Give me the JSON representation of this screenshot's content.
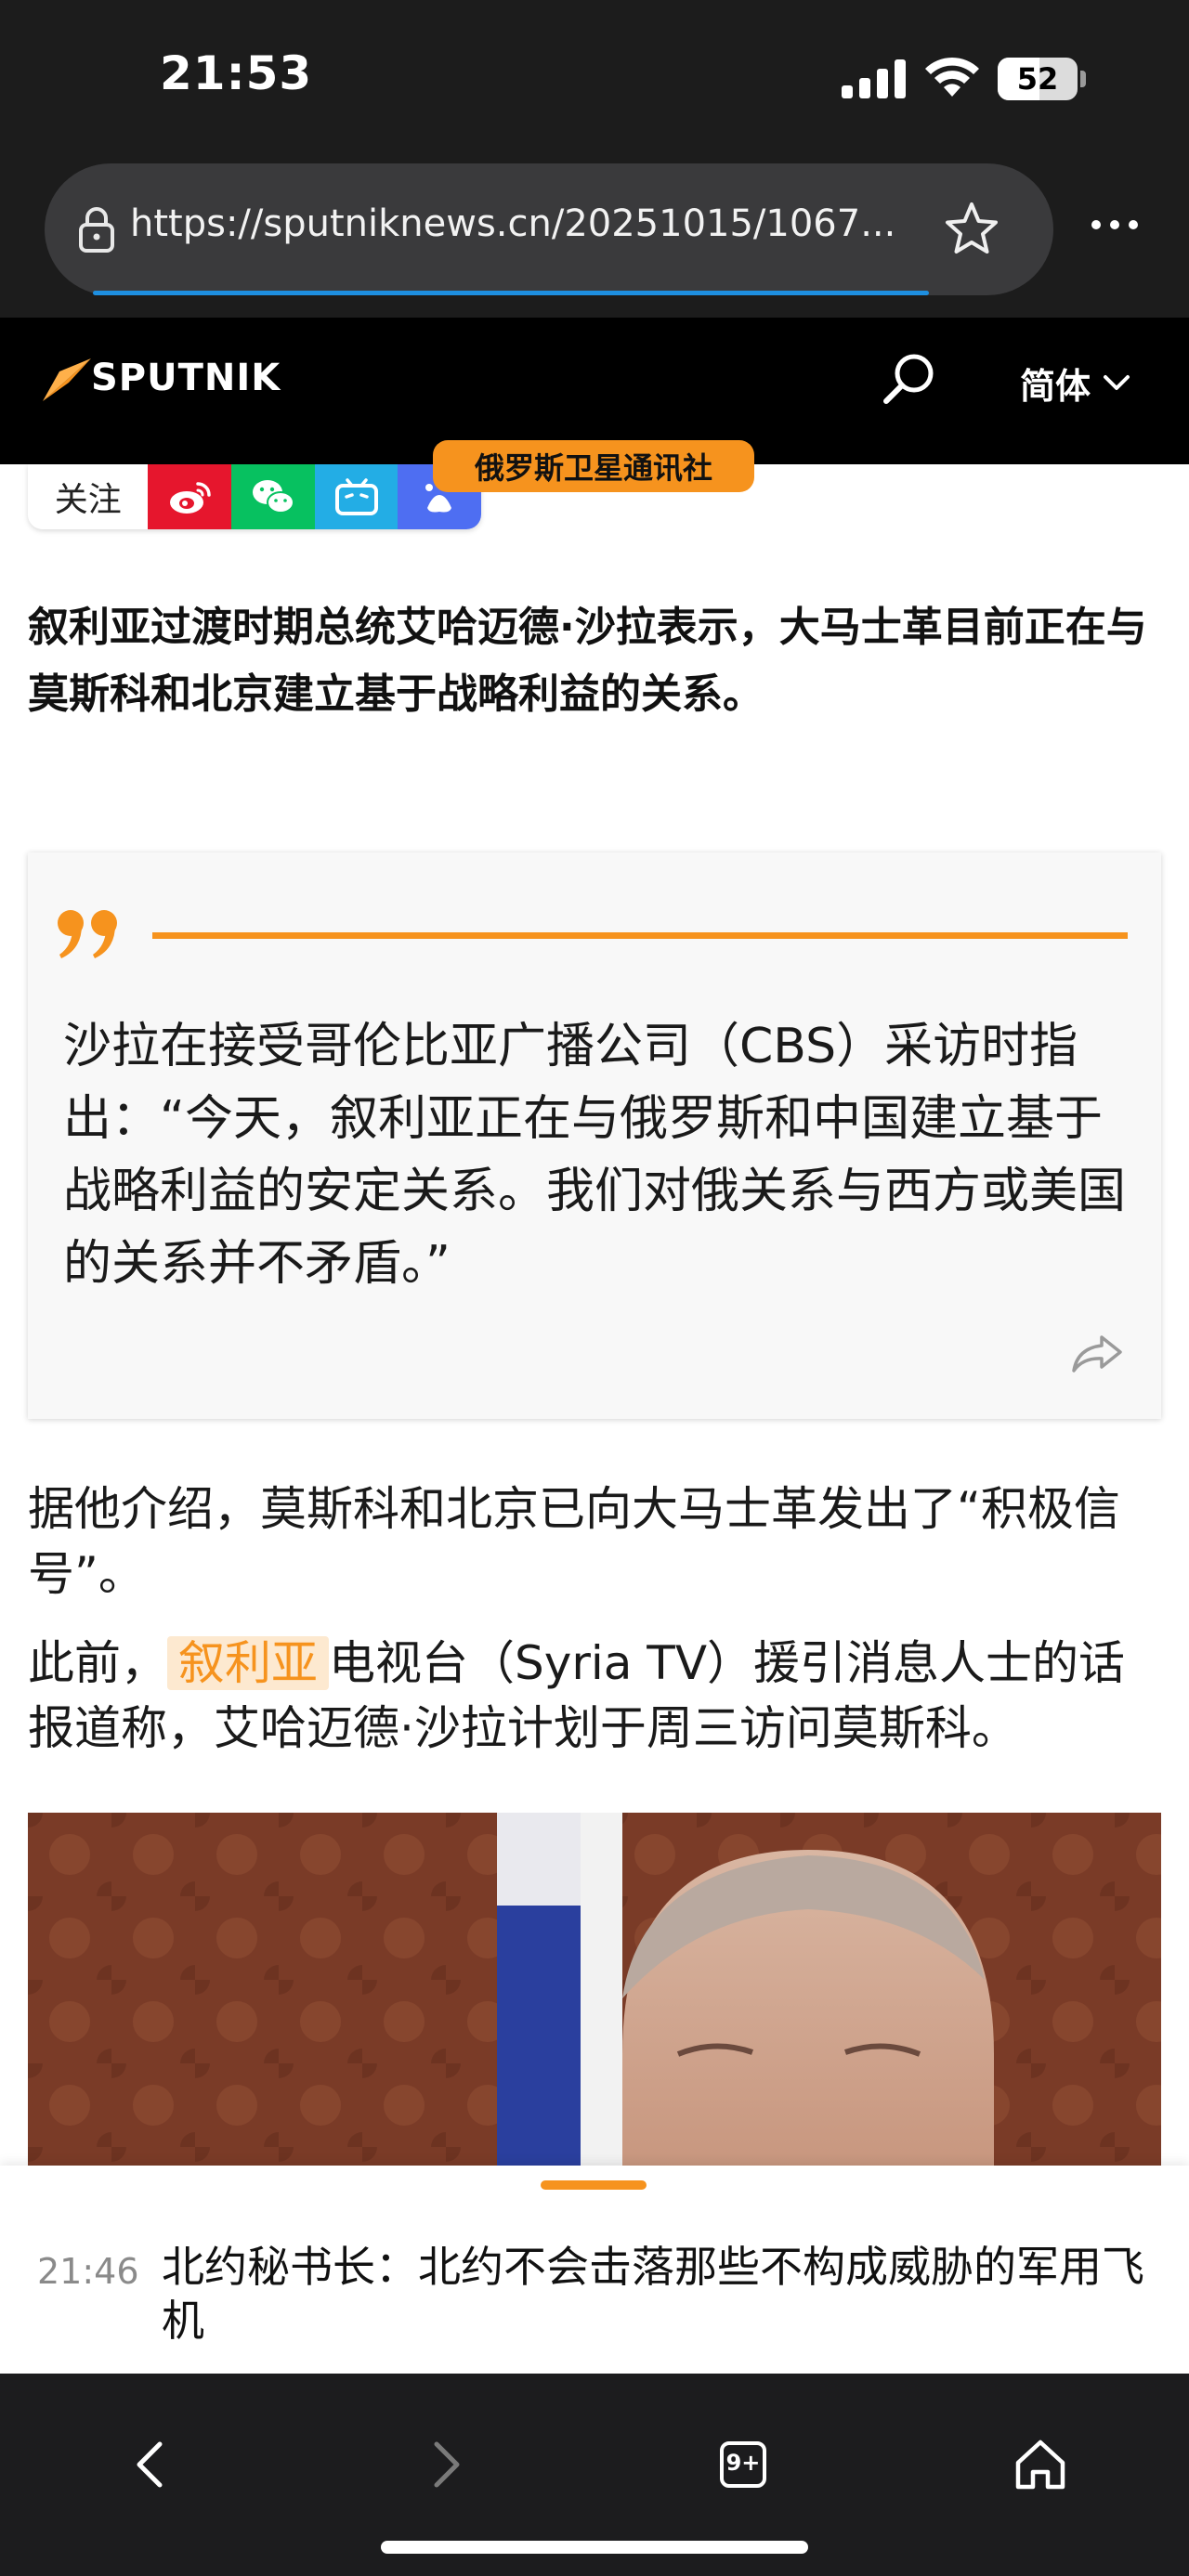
{
  "status_bar": {
    "time": "21:53",
    "battery": "52",
    "battery_level": 0.52
  },
  "browser": {
    "url": "https://sputniknews.cn/20251015/1067..."
  },
  "site_header": {
    "logo_text": "SPUTNIK",
    "language": "简体"
  },
  "follow_bar": {
    "label": "关注",
    "social_icons": [
      "weibo-icon",
      "wechat-icon",
      "bilibili-icon",
      "baidu-icon"
    ],
    "colors": {
      "weibo": "#e6162d",
      "wechat": "#07c160",
      "bilibili": "#23ade5",
      "baidu": "#4e6ef2"
    }
  },
  "agency_badge": "俄罗斯卫星通讯社",
  "article": {
    "lead": "叙利亚过渡时期总统艾哈迈德·沙拉表示，大马士革目前正在与莫斯科和北京建立基于战略利益的关系。",
    "quote": "沙拉在接受哥伦比亚广播公司（CBS）采访时指出：“今天，叙利亚正在与俄罗斯和中国建立基于战略利益的安定关系。我们对俄关系与西方或美国的关系并不矛盾。”",
    "para1": "据他介绍，莫斯科和北京已向大马士革发出了“积极信号”。",
    "para2_prefix": "此前，",
    "para2_link": "叙利亚",
    "para2_suffix": "电视台（Syria TV）援引消息人士的话报道称，艾哈迈德·沙拉计划于周三访问莫斯科。"
  },
  "breaking_news": {
    "time": "21:46",
    "title": "北约秘书长：北约不会击落那些不构成威胁的军用飞机"
  },
  "toolbar": {
    "tabs_count": "9+"
  },
  "colors": {
    "accent": "#f6931e",
    "header_bg": "#000000",
    "browser_bg": "#1c1c1c"
  }
}
